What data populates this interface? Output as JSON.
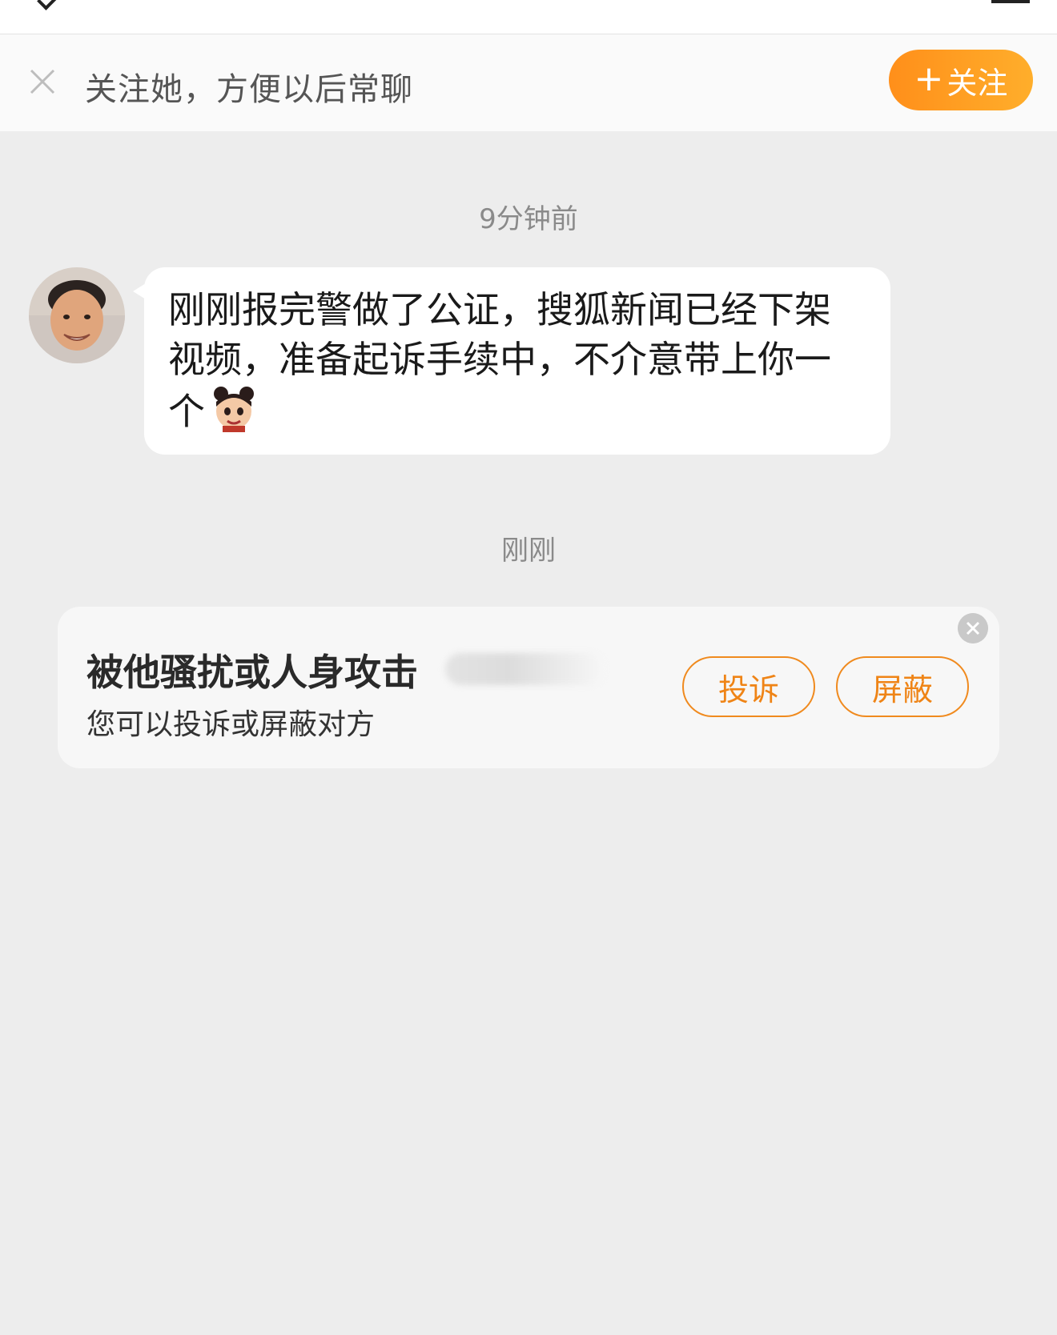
{
  "top_bar": {
    "back_icon": "chevron-left-icon",
    "menu_icon": "menu-icon"
  },
  "follow_bar": {
    "close_icon": "close-icon",
    "prompt": "关注她，方便以后常聊",
    "follow_button": {
      "plus": "+",
      "label": "关注"
    }
  },
  "messages": [
    {
      "timestamp": "9分钟前",
      "sender_avatar": "avatar",
      "text": "刚刚报完警做了公证，搜狐新闻已经下架视频，准备起诉手续中，不介意带上你一个",
      "emoji": "cartoon-character-sticker"
    }
  ],
  "system_notice": {
    "timestamp": "刚刚",
    "title": "被他骚扰或人身攻击",
    "subtitle": "您可以投诉或屏蔽对方",
    "complain_label": "投诉",
    "block_label": "屏蔽",
    "close_icon": "close-circle-icon"
  },
  "colors": {
    "accent_orange": "#ff9a1f",
    "background": "#ededed",
    "bubble": "#ffffff",
    "card": "#f7f7f7"
  }
}
